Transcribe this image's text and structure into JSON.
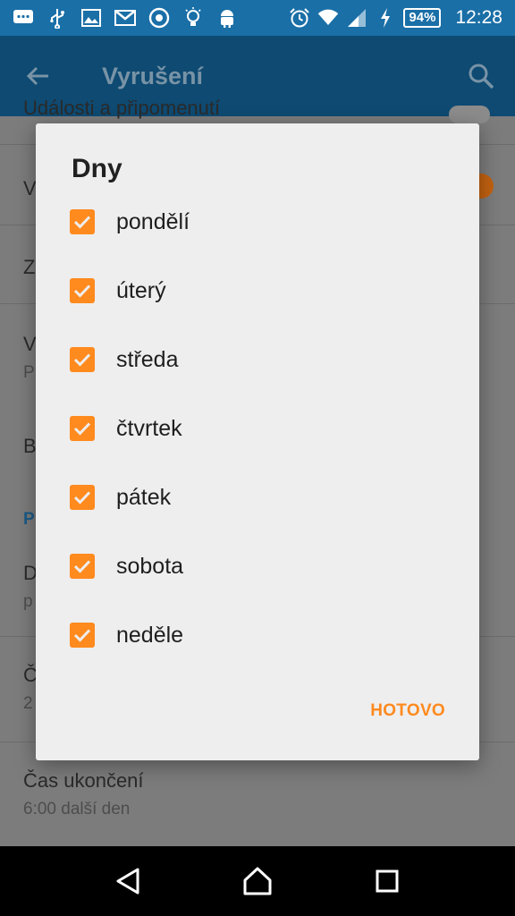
{
  "status_bar": {
    "battery": "94%",
    "time": "12:28",
    "icons": [
      "chat-icon",
      "usb-icon",
      "image-icon",
      "gmail-icon",
      "sync-icon",
      "bulb-icon",
      "android-icon",
      "alarm-icon",
      "wifi-icon",
      "signal-icon",
      "charging-icon"
    ]
  },
  "app_bar": {
    "title": "Vyrušení",
    "back_icon": "arrow-back-icon",
    "search_icon": "search-icon"
  },
  "background_list": {
    "rows": [
      {
        "title": "Události a připomenutí"
      },
      {
        "title": "V"
      },
      {
        "title": "Z"
      },
      {
        "title": "V",
        "subtitle": "P"
      },
      {
        "title": "B"
      }
    ],
    "section": "P",
    "row_d": {
      "title": "D",
      "subtitle": "p"
    },
    "row_c": {
      "title": "Č",
      "subtitle": "2"
    },
    "end_time": {
      "title": "Čas ukončení",
      "subtitle": "6:00 další den"
    }
  },
  "dialog": {
    "title": "Dny",
    "days": [
      {
        "label": "pondělí",
        "checked": true
      },
      {
        "label": "úterý",
        "checked": true
      },
      {
        "label": "středa",
        "checked": true
      },
      {
        "label": "čtvrtek",
        "checked": true
      },
      {
        "label": "pátek",
        "checked": true
      },
      {
        "label": "sobota",
        "checked": true
      },
      {
        "label": "neděle",
        "checked": true
      }
    ],
    "done_label": "HOTOVO"
  },
  "colors": {
    "accent": "#ff8a1e",
    "status_bar": "#1a6fa7",
    "app_bar_dimmed": "#0e4a72"
  }
}
